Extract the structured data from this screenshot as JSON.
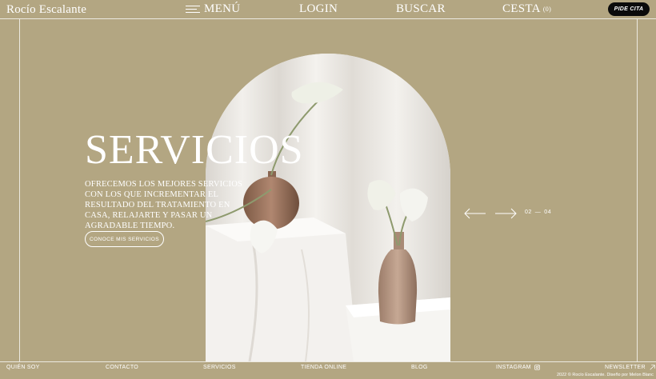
{
  "header": {
    "logo": "Rocío Escalante",
    "menu_label": "MENÚ",
    "login_label": "LOGIN",
    "search_label": "BUSCAR",
    "cart_label": "CESTA",
    "cart_count": "(0)",
    "cta_label": "PIDE CITA"
  },
  "hero": {
    "title": "SERVICIOS",
    "description": "Ofrecemos los mejores servicios con los que incrementar el resultado del tratamiento en casa, relajarte y pasar un agradable tiempo.",
    "button_label": "CONOCE MIS SERVICIOS",
    "slide_current": "02",
    "slide_separator": "—",
    "slide_total": "04"
  },
  "footer": {
    "links": [
      "QUIÉN SOY",
      "CONTACTO",
      "SERVICIOS",
      "TIENDA ONLINE",
      "BLOG",
      "INSTAGRAM",
      "NEWSLETTER"
    ],
    "copyright": "2022 © Rocío Escalante. Diseño por Melon Blanc"
  },
  "colors": {
    "background": "#b3a682",
    "cta_background": "#0b0b0b",
    "text": "#ffffff"
  },
  "icons": {
    "menu": "hamburger-icon",
    "instagram": "instagram-icon",
    "newsletter": "arrow-up-right-icon",
    "prev": "arrow-left-icon",
    "next": "arrow-right-icon"
  }
}
